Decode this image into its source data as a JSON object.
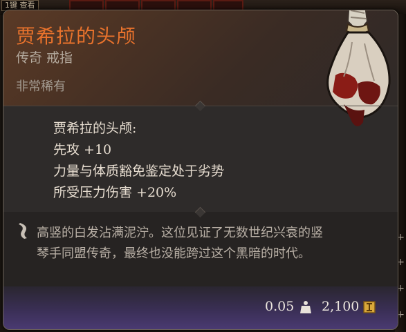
{
  "background": {
    "hotkey_hint": "1键 查看"
  },
  "item": {
    "name": "贾希拉的头颅",
    "type_line": "传奇 戒指",
    "rarity": "非常稀有",
    "icon": "severed-head-in-sack-icon",
    "colors": {
      "name": "#e8722c",
      "text": "#e7ddd0",
      "footer": "#4a3a72"
    }
  },
  "properties": {
    "heading": "贾希拉的头颅:",
    "lines": [
      "先攻 +10",
      "力量与体质豁免鉴定处于劣势",
      "所受压力伤害 +20%"
    ]
  },
  "lore": {
    "icon": "quill-icon",
    "text_line1": "高竖的白发沾满泥泞。这位见证了无数世纪兴衰的竖",
    "text_line2": "琴手同盟传奇，最终也没能跨过这个黑暗的时代。"
  },
  "footer": {
    "weight": "0.05",
    "weight_icon": "weight-icon",
    "price": "2,100",
    "price_icon": "gold-coin-icon"
  }
}
